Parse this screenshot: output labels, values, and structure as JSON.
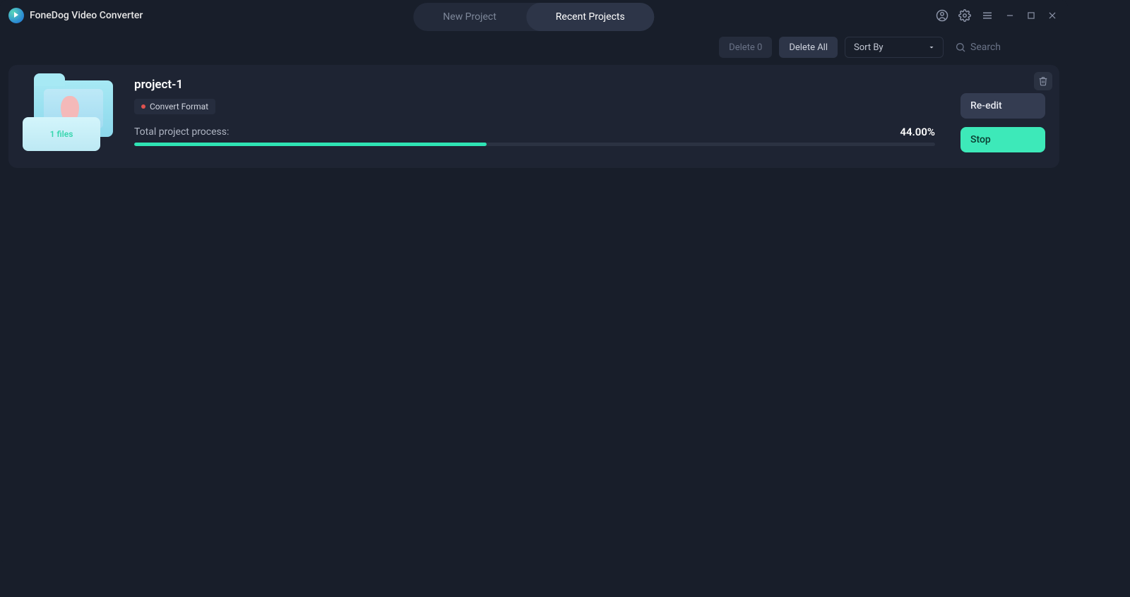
{
  "app": {
    "title": "FoneDog Video Converter"
  },
  "tabs": {
    "new": "New Project",
    "recent": "Recent Projects"
  },
  "toolbar": {
    "delete_n": "Delete 0",
    "delete_all": "Delete All",
    "sort_label": "Sort By",
    "search_placeholder": "Search"
  },
  "project": {
    "title": "project-1",
    "tag_label": "Convert Format",
    "files_label": "1 files",
    "progress_label": "Total project process:",
    "progress_pct_text": "44.00%",
    "progress_pct": 44,
    "reedit_label": "Re-edit",
    "stop_label": "Stop"
  }
}
